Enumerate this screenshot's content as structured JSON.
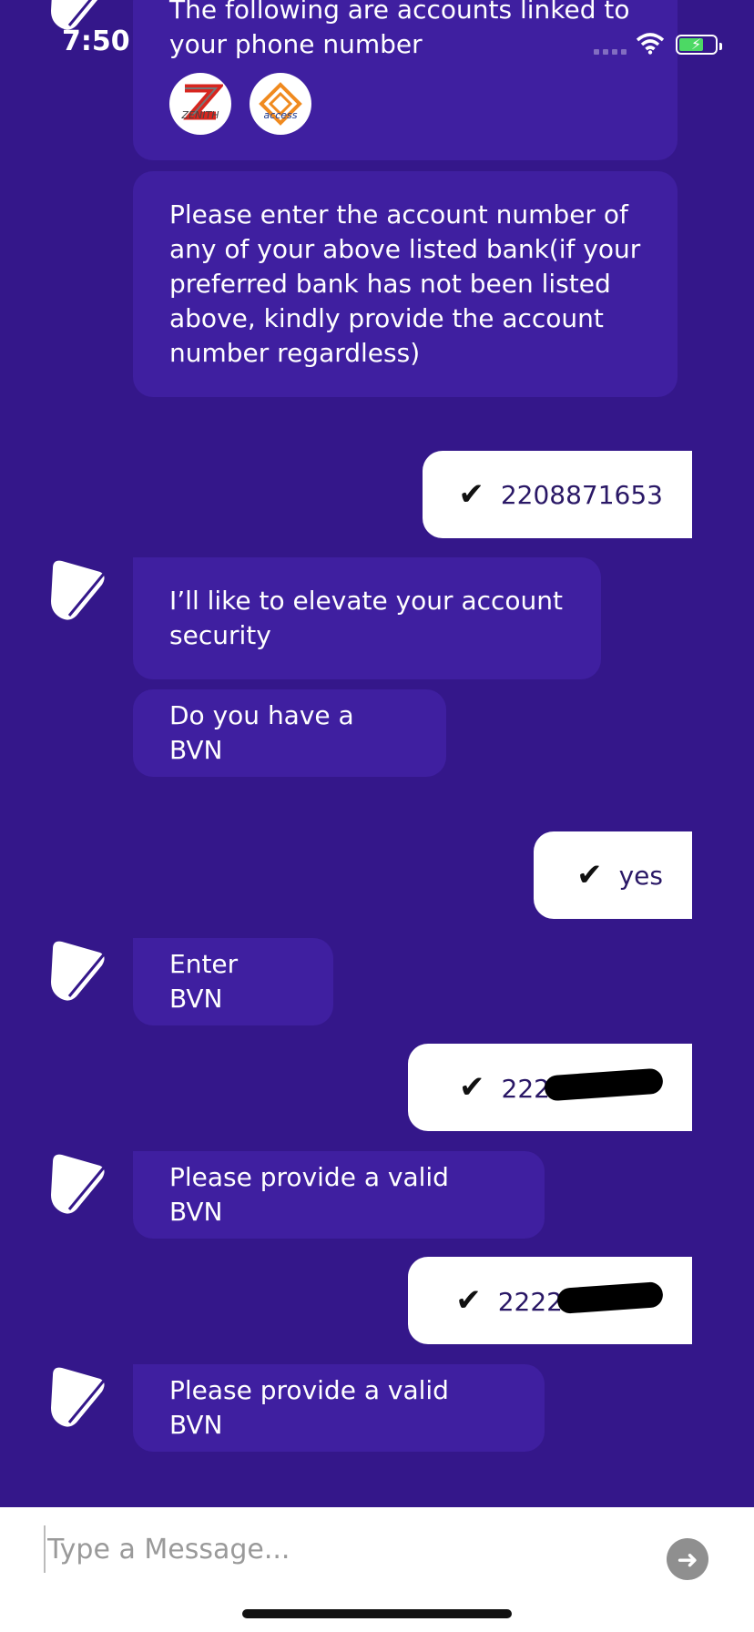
{
  "status": {
    "time": "7:50"
  },
  "messages": {
    "accounts_intro": "The following are accounts linked to your phone number",
    "banks": [
      {
        "name": "ZENITH",
        "color": "#d7261f"
      },
      {
        "name": "access",
        "color": "#f08a1f"
      }
    ],
    "enter_account": "Please enter the account number of any of your above listed bank(if your preferred bank has not been listed above, kindly provide the account number regardless)",
    "user_account": "2208871653",
    "elevate_security": "I’ll like to elevate your account security",
    "ask_bvn": "Do you have a BVN",
    "user_yes": "yes",
    "enter_bvn": "Enter BVN",
    "user_bvn_1": "222",
    "invalid_bvn_1": "Please provide a valid BVN",
    "user_bvn_2": "2222",
    "invalid_bvn_2": "Please provide a valid BVN"
  },
  "input": {
    "placeholder": "Type a Message..."
  },
  "colors": {
    "background": "#34178a",
    "bot_bubble": "#3f1fa0",
    "user_bubble": "#ffffff"
  }
}
